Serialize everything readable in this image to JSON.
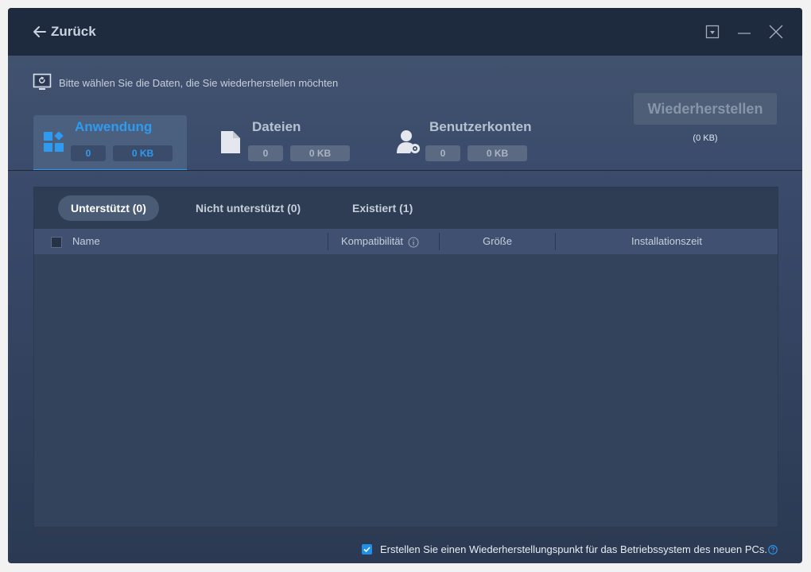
{
  "titlebar": {
    "back_label": "Zurück"
  },
  "prompt": {
    "text": "Bitte wählen Sie die Daten, die Sie wiederherstellen möchten"
  },
  "categories": [
    {
      "label": "Anwendung",
      "count": "0",
      "size": "0 KB",
      "active": true,
      "icon": "apps-icon"
    },
    {
      "label": "Dateien",
      "count": "0",
      "size": "0 KB",
      "active": false,
      "icon": "file-icon"
    },
    {
      "label": "Benutzerkonten",
      "count": "0",
      "size": "0 KB",
      "active": false,
      "icon": "user-settings-icon"
    }
  ],
  "restore": {
    "button_label": "Wiederherstellen",
    "size": "(0 KB)"
  },
  "subtabs": [
    {
      "label": "Unterstützt (0)",
      "active": true
    },
    {
      "label": "Nicht unterstützt (0)",
      "active": false
    },
    {
      "label": "Existiert (1)",
      "active": false
    }
  ],
  "table": {
    "columns": [
      "Name",
      "Kompatibilität",
      "Größe",
      "Installationszeit"
    ],
    "rows": []
  },
  "footer": {
    "checkbox_checked": true,
    "text": "Erstellen Sie einen Wiederherstellungspunkt für das Betriebssystem des neuen PCs."
  },
  "colors": {
    "accent": "#2e9bf0",
    "titlebar": "#1e2a3e",
    "background": "#3a4a66"
  }
}
